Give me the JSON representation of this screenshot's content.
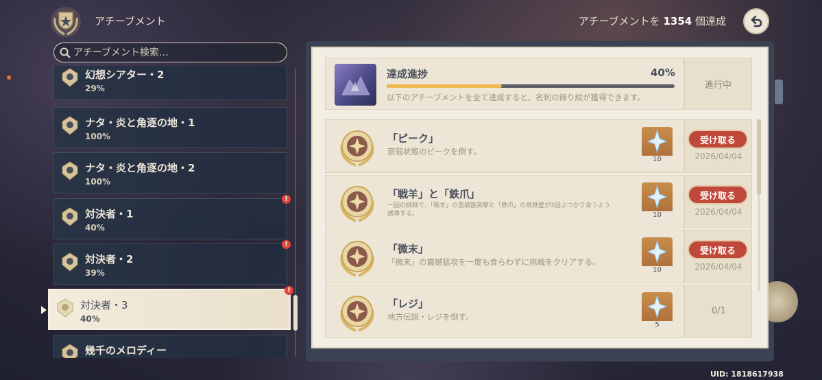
{
  "header": {
    "title": "アチーブメント",
    "count_prefix": "アチーブメントを",
    "count_value": "1354",
    "count_suffix": "個達成"
  },
  "search": {
    "placeholder": "アチーブメント検索…"
  },
  "categories": [
    {
      "name": "幻想シアター・2",
      "percent": "29%",
      "alert": false,
      "selected": false
    },
    {
      "name": "ナタ・炎と角逐の地・1",
      "percent": "100%",
      "alert": false,
      "selected": false
    },
    {
      "name": "ナタ・炎と角逐の地・2",
      "percent": "100%",
      "alert": false,
      "selected": false
    },
    {
      "name": "対決者・1",
      "percent": "40%",
      "alert": true,
      "selected": false
    },
    {
      "name": "対決者・2",
      "percent": "39%",
      "alert": true,
      "selected": false
    },
    {
      "name": "対決者・3",
      "percent": "40%",
      "alert": true,
      "selected": true
    },
    {
      "name": "幾千のメロディー",
      "percent": "",
      "alert": false,
      "selected": false
    }
  ],
  "alert_glyph": "!",
  "progress": {
    "title": "達成進捗",
    "percent_label": "40%",
    "percent_value": 0.4,
    "description": "以下のアチーブメントを全て達成すると、名刺の飾り紋が獲得できます。",
    "status": "進行中",
    "fill_color": "#f0b650"
  },
  "achievements": [
    {
      "title": "「ピーク」",
      "description": "衰弱状態のピークを倒す。",
      "reward_qty": "10",
      "button": "受け取る",
      "date": "2026/04/04",
      "progress": ""
    },
    {
      "title": "「戦羊」と「鉄爪」",
      "description": "一回の挑戦で、「戦羊」の蛮騎獣突撃と「鉄爪」の鳥鉄壁が2回ぶつかり合うよう誘導する。",
      "reward_qty": "10",
      "button": "受け取る",
      "date": "2026/04/04",
      "progress": ""
    },
    {
      "title": "「微末」",
      "description": "「微末」の震撼猛攻を一度も食らわずに挑戦をクリアする。",
      "reward_qty": "10",
      "button": "受け取る",
      "date": "2026/04/04",
      "progress": ""
    },
    {
      "title": "「レジ」",
      "description": "地方伝説・レジを倒す。",
      "reward_qty": "5",
      "button": "",
      "date": "",
      "progress": "0/1"
    }
  ],
  "uid": "UID: 1818617938",
  "colors": {
    "accent_gold": "#f0b650",
    "claim_red": "#c0483a",
    "paper": "#f3eee3",
    "text_dark": "#4a4f5c"
  },
  "icons": {
    "header": "achievement-trophy-icon",
    "back": "back-arrow-icon",
    "search": "search-icon",
    "category": "category-emblem-icon",
    "badge": "achievement-badge-icon",
    "reward": "primogem-icon"
  }
}
